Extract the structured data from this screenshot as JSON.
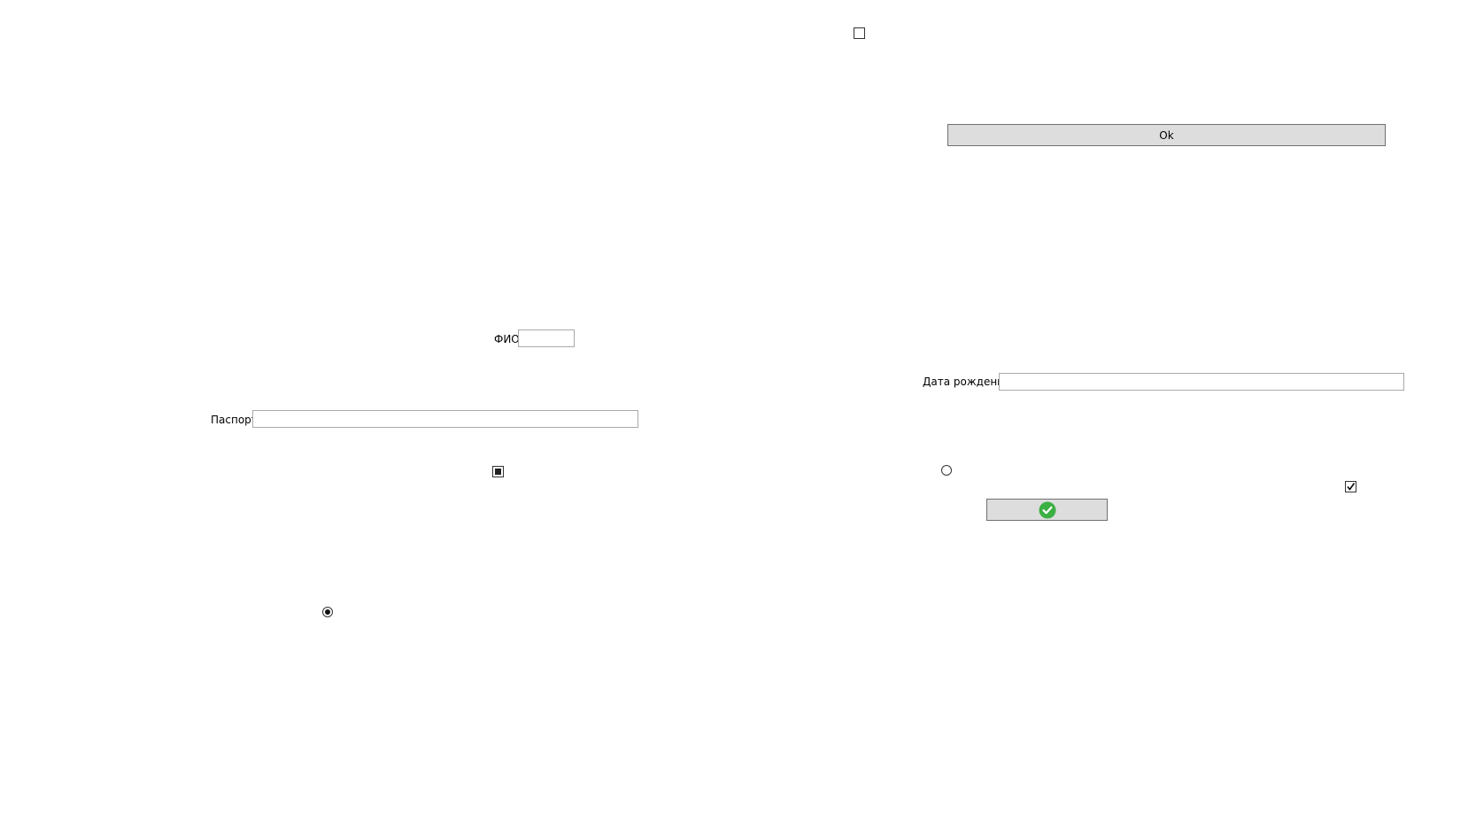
{
  "form": {
    "fio_label": "ФИО",
    "fio_value": "",
    "passport_label": "Паспорт",
    "passport_value": "",
    "birthdate_label": "Дата рождения",
    "birthdate_value": "",
    "ok_button_label": "Ok",
    "confirm_button_icon": "green-check-circle-icon",
    "checkbox_top_state": "unchecked",
    "checkbox_left_state": "indeterminate",
    "checkbox_right_state": "checked",
    "radio_left_state": "checked",
    "radio_right_state": "unchecked"
  },
  "colors": {
    "button_bg": "#dddddd",
    "accent_green": "#3cb043"
  }
}
